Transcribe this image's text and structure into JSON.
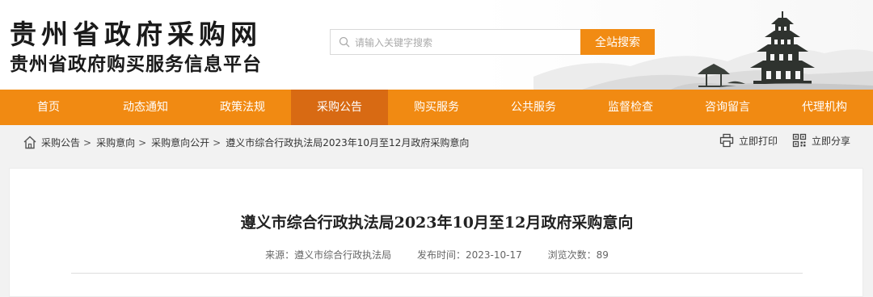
{
  "header": {
    "site_title": "贵州省政府采购网",
    "site_subtitle": "贵州省政府购买服务信息平台",
    "search": {
      "placeholder": "请输入关键字搜索",
      "button_label": "全站搜索"
    }
  },
  "nav": {
    "items": [
      "首页",
      "动态通知",
      "政策法规",
      "采购公告",
      "购买服务",
      "公共服务",
      "监督检查",
      "咨询留言",
      "代理机构"
    ],
    "active": "采购公告"
  },
  "breadcrumb": [
    "采购公告",
    "采购意向",
    "采购意向公开",
    "遵义市综合行政执法局2023年10月至12月政府采购意向"
  ],
  "tools": {
    "print": "立即打印",
    "share": "立即分享"
  },
  "article": {
    "title": "遵义市综合行政执法局2023年10月至12月政府采购意向",
    "source": "来源：遵义市综合行政执法局",
    "publish_time": "发布时间：2023-10-17",
    "views": "浏览次数：89"
  },
  "colors": {
    "accent": "#f18a12",
    "nav_active": "#d86a13"
  }
}
